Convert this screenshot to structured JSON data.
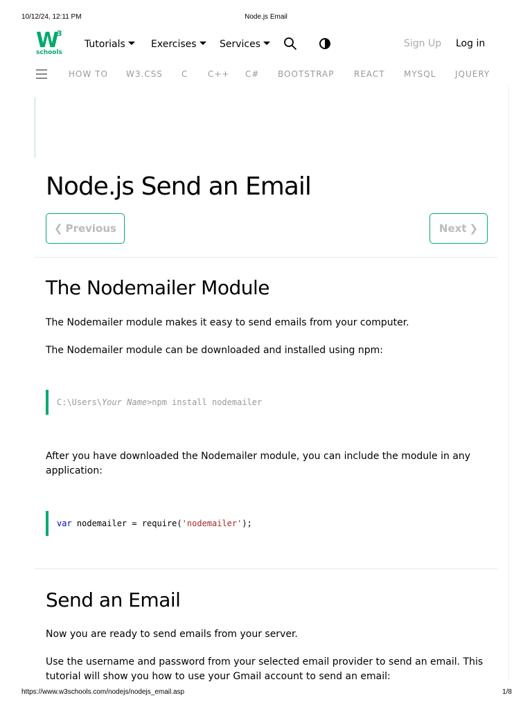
{
  "print_header": {
    "datetime": "10/12/24, 12:11 PM",
    "doc_title": "Node.js Email"
  },
  "print_footer": {
    "url": "https://www.w3schools.com/nodejs/nodejs_email.asp",
    "page": "1/8"
  },
  "logo": {
    "main": "W",
    "sup": "3",
    "sub": "schools"
  },
  "topnav": {
    "tutorials": "Tutorials",
    "exercises": "Exercises",
    "services": "Services",
    "signup": "Sign Up",
    "login": "Log in"
  },
  "subnav": [
    "HOW TO",
    "W3.CSS",
    "C",
    "C++",
    "C#",
    "BOOTSTRAP",
    "REACT",
    "MYSQL",
    "JQUERY"
  ],
  "page": {
    "title": "Node.js Send an Email",
    "prev_label": "Previous",
    "next_label": "Next"
  },
  "section1": {
    "heading": "The Nodemailer Module",
    "p1": "The Nodemailer module makes it easy to send emails from your computer.",
    "p2": "The Nodemailer module can be downloaded and installed using npm:",
    "code1": {
      "prefix": "C:\\Users\\",
      "italic": "Your Name",
      "suffix": ">npm install nodemailer"
    },
    "p3": "After you have downloaded the Nodemailer module, you can include the module in any application:",
    "code2": {
      "kw": "var",
      "mid": " nodemailer = require(",
      "str": "'nodemailer'",
      "end": ");"
    }
  },
  "section2": {
    "heading": "Send an Email",
    "p1": "Now you are ready to send emails from your server.",
    "p2": "Use the username and password from your selected email provider to send an email. This tutorial will show you how to use your Gmail account to send an email:"
  },
  "colors": {
    "accent": "#04aa6d",
    "keyword": "#0000cd",
    "string": "#a52a2a"
  },
  "icons": [
    "search-icon",
    "contrast-icon",
    "hamburger-icon",
    "chevron-left-icon",
    "chevron-right-icon"
  ]
}
